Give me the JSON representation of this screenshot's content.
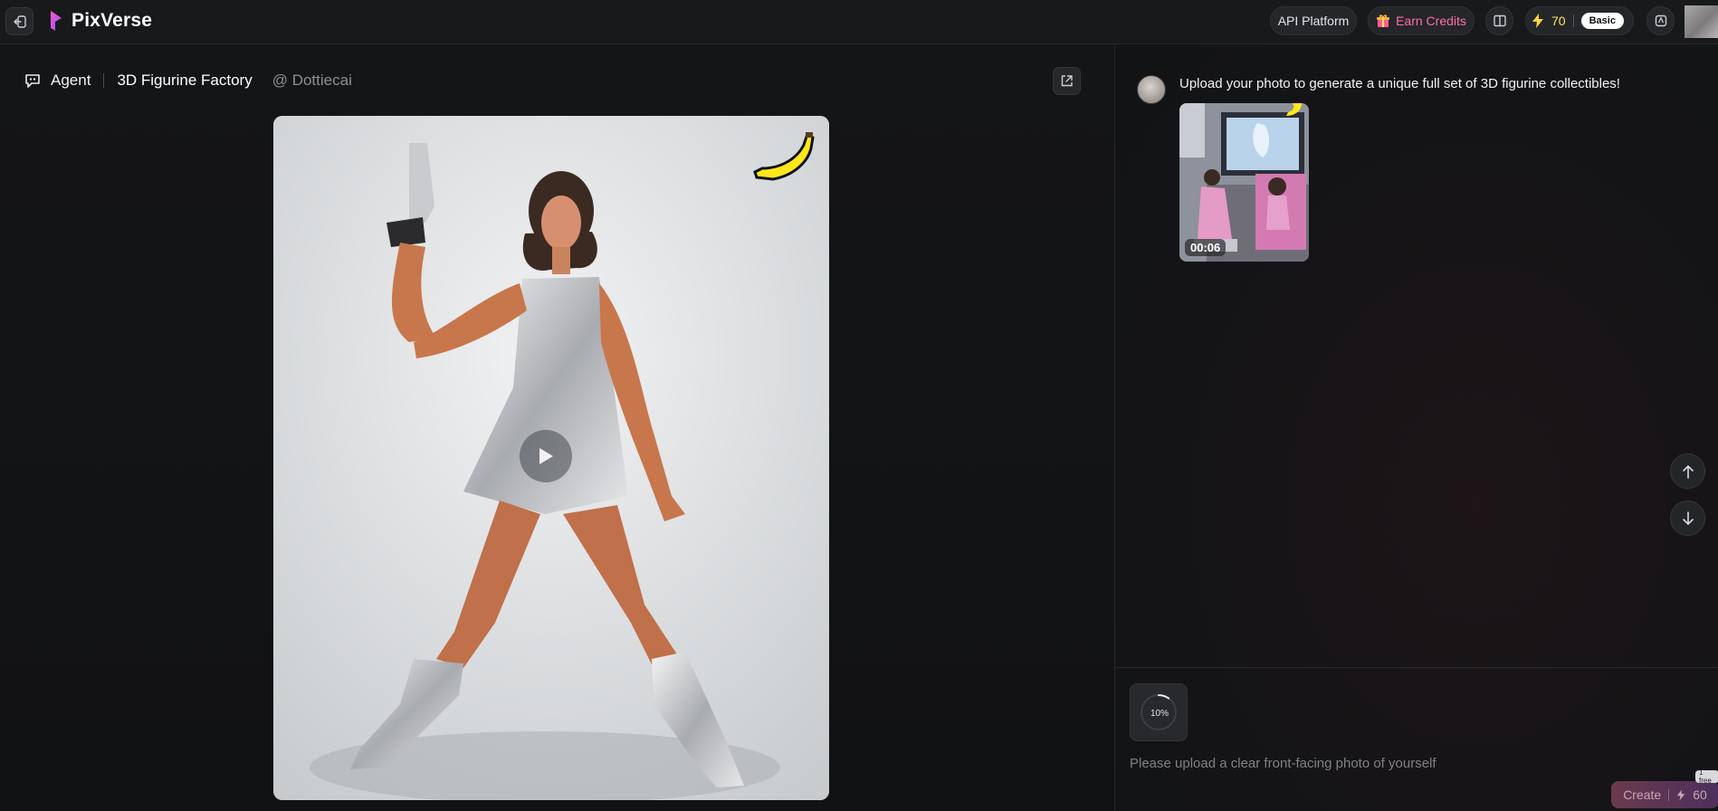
{
  "header": {
    "brand": "PixVerse",
    "api_platform": "API Platform",
    "earn_credits": "Earn Credits",
    "credits": "70",
    "plan": "Basic"
  },
  "breadcrumb": {
    "agent": "Agent",
    "title": "3D Figurine Factory",
    "author": "@ Dottiecai"
  },
  "chat": {
    "message": "Upload your photo to generate a unique full set of 3D figurine collectibles!",
    "video_duration": "00:06"
  },
  "composer": {
    "progress": "10%",
    "placeholder": "Please upload a clear front-facing photo of yourself",
    "create_label": "Create",
    "create_cost": "60",
    "free_tag": "1 free"
  },
  "colors": {
    "accent_pink": "#ff6fa4",
    "credit_yellow": "#ffe35b",
    "background": "#121315"
  },
  "icons": [
    "back-icon",
    "pixverse-logo-icon",
    "gift-icon",
    "book-icon",
    "lightning-icon",
    "shield-icon",
    "agent-icon",
    "share-icon",
    "play-icon",
    "banana-icon",
    "arrow-up-icon",
    "arrow-down-icon",
    "progress-ring-icon"
  ]
}
